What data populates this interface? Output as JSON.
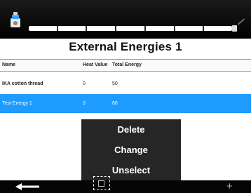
{
  "header": {
    "title": "External Energies 1"
  },
  "table": {
    "columns": [
      "Name",
      "Heat Value",
      "Total Energy"
    ],
    "rows": [
      {
        "name": "IKA cotton thread",
        "heat_value": "0",
        "total_energy": "50",
        "selected": false
      },
      {
        "name": "Test Energy 1",
        "heat_value": "0",
        "total_energy": "60",
        "selected": true
      }
    ]
  },
  "context_menu": {
    "items": [
      "Delete",
      "Change",
      "Unselect"
    ]
  },
  "toolbar": {
    "plus_label": "+"
  },
  "colors": {
    "selection": "#1e9bff",
    "menu_bg": "#262626",
    "bar_bg": "#050505"
  },
  "icons": {
    "app": "blender-icon",
    "back": "back-arrow-icon",
    "edit": "edit-icon"
  }
}
